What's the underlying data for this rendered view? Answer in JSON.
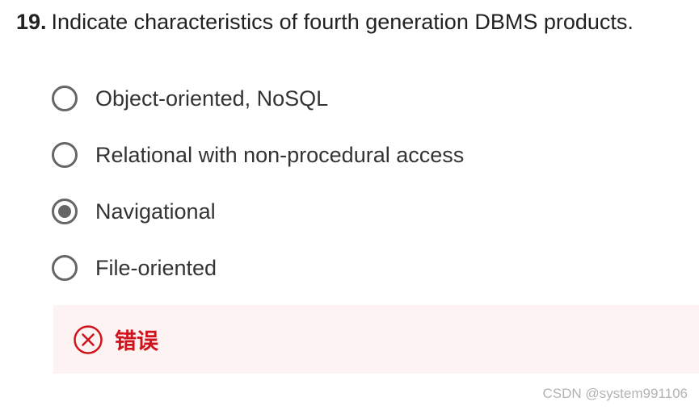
{
  "question": {
    "number": "19.",
    "text": "Indicate characteristics of fourth generation DBMS products."
  },
  "options": [
    {
      "label": "Object-oriented, NoSQL",
      "selected": false
    },
    {
      "label": "Relational with non-procedural access",
      "selected": false
    },
    {
      "label": "Navigational",
      "selected": true
    },
    {
      "label": "File-oriented",
      "selected": false
    }
  ],
  "feedback": {
    "icon": "x-circle-icon",
    "text": "错误",
    "color": "#d0121b",
    "background": "#fdf3f3"
  },
  "watermark": "CSDN @system991106"
}
